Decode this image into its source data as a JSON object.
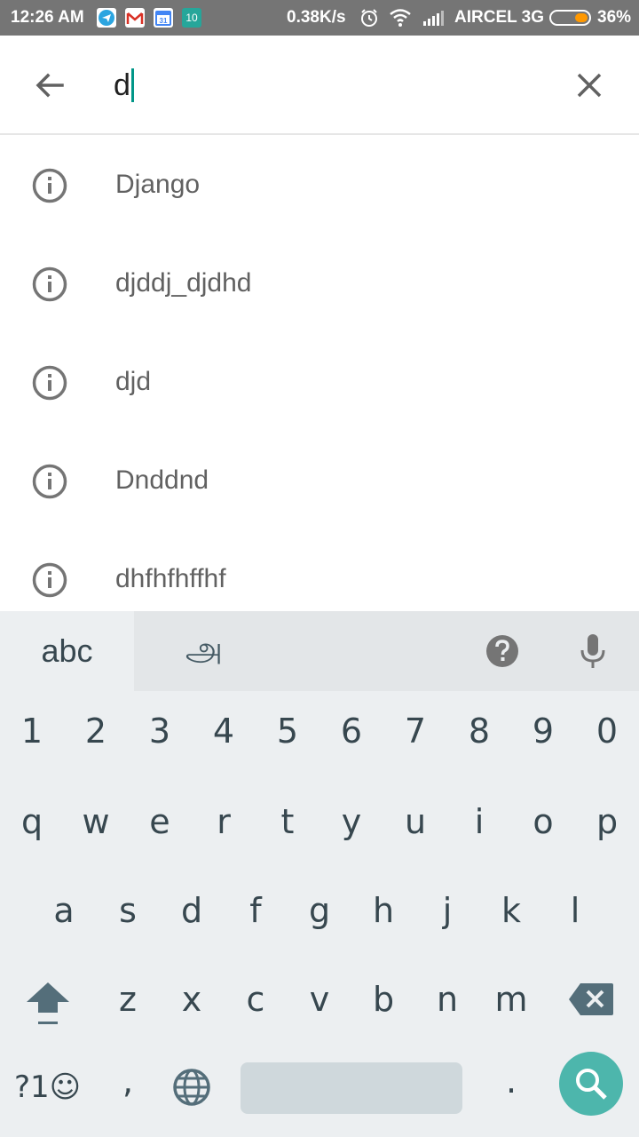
{
  "status_bar": {
    "time": "12:26 AM",
    "calendar_day": "31",
    "notification_count": "10",
    "net_speed": "0.38K/s",
    "carrier": "AIRCEL 3G",
    "battery": "36%",
    "battery_level": 0.36
  },
  "search": {
    "query": "d",
    "back_icon": "arrow-left-icon",
    "clear_icon": "close-icon"
  },
  "suggestions": [
    {
      "label": "Django",
      "icon": "info-icon"
    },
    {
      "label": "djddj_djdhd",
      "icon": "info-icon"
    },
    {
      "label": "djd",
      "icon": "info-icon"
    },
    {
      "label": "Dnddnd",
      "icon": "info-icon"
    },
    {
      "label": "dhfhfhffhf",
      "icon": "info-icon"
    }
  ],
  "keyboard": {
    "tab_abc": "abc",
    "tab_tamil": "அ",
    "number_row": [
      "1",
      "2",
      "3",
      "4",
      "5",
      "6",
      "7",
      "8",
      "9",
      "0"
    ],
    "row_q": [
      "q",
      "w",
      "e",
      "r",
      "t",
      "y",
      "u",
      "i",
      "o",
      "p"
    ],
    "row_a": [
      "a",
      "s",
      "d",
      "f",
      "g",
      "h",
      "j",
      "k",
      "l"
    ],
    "row_z": [
      "z",
      "x",
      "c",
      "v",
      "b",
      "n",
      "m"
    ],
    "symbols_label": "?1☺",
    "comma": ",",
    "period": ".",
    "accent_color": "#4db6ac"
  }
}
